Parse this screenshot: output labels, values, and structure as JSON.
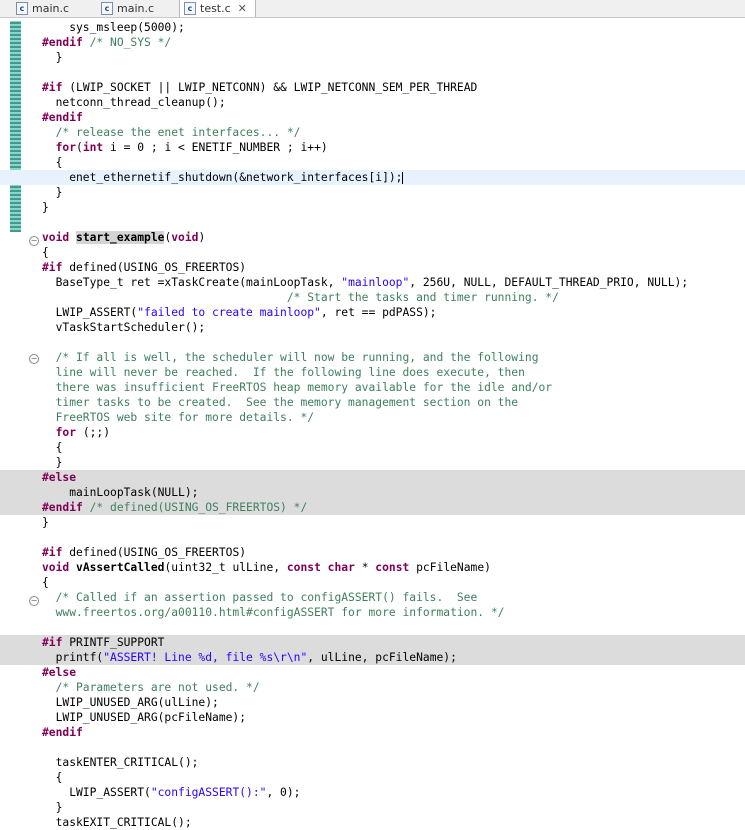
{
  "tabs": [
    {
      "label": "main.c",
      "icon": "c-file-icon",
      "active": false
    },
    {
      "label": "main.c",
      "icon": "c-file-icon",
      "active": false
    },
    {
      "label": "test.c",
      "icon": "c-file-icon",
      "active": true,
      "close": "✕"
    }
  ],
  "code": [
    {
      "k": "n",
      "t": [
        [
          "p",
          "    sys_msleep(5000);"
        ]
      ]
    },
    {
      "k": "n",
      "t": [
        [
          "kw",
          "#endif "
        ],
        [
          "cm",
          "/* NO_SYS */"
        ]
      ]
    },
    {
      "k": "n",
      "t": [
        [
          "p",
          "  }"
        ]
      ]
    },
    {
      "k": "n",
      "t": []
    },
    {
      "k": "n",
      "t": [
        [
          "kw",
          "#if "
        ],
        [
          "p",
          "(LWIP_SOCKET || LWIP_NETCONN) && LWIP_NETCONN_SEM_PER_THREAD"
        ]
      ]
    },
    {
      "k": "n",
      "t": [
        [
          "p",
          "  netconn_thread_cleanup();"
        ]
      ]
    },
    {
      "k": "n",
      "t": [
        [
          "kw",
          "#endif"
        ]
      ]
    },
    {
      "k": "n",
      "t": [
        [
          "cm",
          "  /* release the enet interfaces... */"
        ]
      ]
    },
    {
      "k": "n",
      "t": [
        [
          "p",
          "  "
        ],
        [
          "kw",
          "for"
        ],
        [
          "p",
          "("
        ],
        [
          "kw",
          "int"
        ],
        [
          "p",
          " i = 0 ; i < ENETIF_NUMBER ; i++)"
        ]
      ]
    },
    {
      "k": "n",
      "t": [
        [
          "p",
          "  {"
        ]
      ]
    },
    {
      "k": "cur",
      "t": [
        [
          "p",
          "    enet_ethernetif_shutdown(&network_interfaces[i]);"
        ]
      ],
      "caret": true
    },
    {
      "k": "n",
      "t": [
        [
          "p",
          "  }"
        ]
      ]
    },
    {
      "k": "n",
      "t": [
        [
          "p",
          "}"
        ]
      ]
    },
    {
      "k": "n",
      "t": []
    },
    {
      "k": "n",
      "t": [
        [
          "kw",
          "void "
        ],
        [
          "hl",
          "start_example"
        ],
        [
          "p",
          "("
        ],
        [
          "kw",
          "void"
        ],
        [
          "p",
          ")"
        ]
      ]
    },
    {
      "k": "n",
      "t": [
        [
          "p",
          "{"
        ]
      ]
    },
    {
      "k": "n",
      "t": [
        [
          "kw",
          "#if "
        ],
        [
          "p",
          "defined(USING_OS_FREERTOS)"
        ]
      ]
    },
    {
      "k": "n",
      "t": [
        [
          "p",
          "  BaseType_t ret =xTaskCreate(mainLoopTask, "
        ],
        [
          "st",
          "\"mainloop\""
        ],
        [
          "p",
          ", 256U, NULL, DEFAULT_THREAD_PRIO, NULL);"
        ]
      ]
    },
    {
      "k": "n",
      "t": [
        [
          "cm",
          "                                    /* Start the tasks and timer running. */"
        ]
      ]
    },
    {
      "k": "n",
      "t": [
        [
          "p",
          "  LWIP_ASSERT("
        ],
        [
          "st",
          "\"failed to create mainloop\""
        ],
        [
          "p",
          ", ret == pdPASS);"
        ]
      ]
    },
    {
      "k": "n",
      "t": [
        [
          "p",
          "  vTaskStartScheduler();"
        ]
      ]
    },
    {
      "k": "n",
      "t": []
    },
    {
      "k": "n",
      "t": [
        [
          "cm",
          "  /* If all is well, the scheduler will now be running, and the following"
        ]
      ]
    },
    {
      "k": "n",
      "t": [
        [
          "cm",
          "  line will never be reached.  If the following line does execute, then"
        ]
      ]
    },
    {
      "k": "n",
      "t": [
        [
          "cm",
          "  there was insufficient FreeRTOS heap memory available for the idle and/or"
        ]
      ]
    },
    {
      "k": "n",
      "t": [
        [
          "cm",
          "  timer tasks to be created.  See the memory management section on the"
        ]
      ]
    },
    {
      "k": "n",
      "t": [
        [
          "cm",
          "  FreeRTOS web site for more details. */"
        ]
      ]
    },
    {
      "k": "n",
      "t": [
        [
          "p",
          "  "
        ],
        [
          "kw",
          "for"
        ],
        [
          "p",
          " (;;)"
        ]
      ]
    },
    {
      "k": "n",
      "t": [
        [
          "p",
          "  {"
        ]
      ]
    },
    {
      "k": "n",
      "t": [
        [
          "p",
          "  }"
        ]
      ]
    },
    {
      "k": "gray",
      "t": [
        [
          "kw",
          "#else"
        ]
      ]
    },
    {
      "k": "gray",
      "t": [
        [
          "p",
          "    mainLoopTask(NULL);"
        ]
      ]
    },
    {
      "k": "gray",
      "t": [
        [
          "kw",
          "#endif "
        ],
        [
          "cm",
          "/* defined(USING_OS_FREERTOS) */"
        ]
      ]
    },
    {
      "k": "n",
      "t": [
        [
          "p",
          "}"
        ]
      ]
    },
    {
      "k": "n",
      "t": []
    },
    {
      "k": "n",
      "t": [
        [
          "kw",
          "#if "
        ],
        [
          "p",
          "defined(USING_OS_FREERTOS)"
        ]
      ]
    },
    {
      "k": "n",
      "t": [
        [
          "kw",
          "void "
        ],
        [
          "fn",
          "vAssertCalled"
        ],
        [
          "p",
          "(uint32_t ulLine, "
        ],
        [
          "kw",
          "const char"
        ],
        [
          "p",
          " * "
        ],
        [
          "kw",
          "const"
        ],
        [
          "p",
          " pcFileName)"
        ]
      ]
    },
    {
      "k": "n",
      "t": [
        [
          "p",
          "{"
        ]
      ]
    },
    {
      "k": "n",
      "t": [
        [
          "cm",
          "  /* Called if an assertion passed to configASSERT() fails.  See"
        ]
      ]
    },
    {
      "k": "n",
      "t": [
        [
          "cm",
          "  www.freertos.org/a00110.html#configASSERT for more information. */"
        ]
      ]
    },
    {
      "k": "n",
      "t": []
    },
    {
      "k": "gray",
      "t": [
        [
          "kw",
          "#if "
        ],
        [
          "p",
          "PRINTF_SUPPORT"
        ]
      ]
    },
    {
      "k": "gray",
      "t": [
        [
          "p",
          "  printf("
        ],
        [
          "st",
          "\"ASSERT! Line %d, file %s\\r\\n\""
        ],
        [
          "p",
          ", ulLine, pcFileName);"
        ]
      ]
    },
    {
      "k": "n",
      "t": [
        [
          "kw",
          "#else"
        ]
      ]
    },
    {
      "k": "n",
      "t": [
        [
          "cm",
          "  /* Parameters are not used. */"
        ]
      ]
    },
    {
      "k": "n",
      "t": [
        [
          "p",
          "  LWIP_UNUSED_ARG(ulLine);"
        ]
      ]
    },
    {
      "k": "n",
      "t": [
        [
          "p",
          "  LWIP_UNUSED_ARG(pcFileName);"
        ]
      ]
    },
    {
      "k": "n",
      "t": [
        [
          "kw",
          "#endif"
        ]
      ]
    },
    {
      "k": "n",
      "t": []
    },
    {
      "k": "n",
      "t": [
        [
          "p",
          "  taskENTER_CRITICAL();"
        ]
      ]
    },
    {
      "k": "n",
      "t": [
        [
          "p",
          "  {"
        ]
      ]
    },
    {
      "k": "n",
      "t": [
        [
          "p",
          "    LWIP_ASSERT("
        ],
        [
          "st",
          "\"configASSERT():\""
        ],
        [
          "p",
          ", 0);"
        ]
      ]
    },
    {
      "k": "n",
      "t": [
        [
          "p",
          "  }"
        ]
      ]
    },
    {
      "k": "n",
      "t": [
        [
          "p",
          "  taskEXIT_CRITICAL();"
        ]
      ]
    }
  ],
  "colors": {
    "keyword": "#7f0055",
    "comment": "#3f7f5f",
    "string": "#2a00ff",
    "inactive_bg": "#dcdcdc",
    "current_line": "#e8f2fe"
  }
}
